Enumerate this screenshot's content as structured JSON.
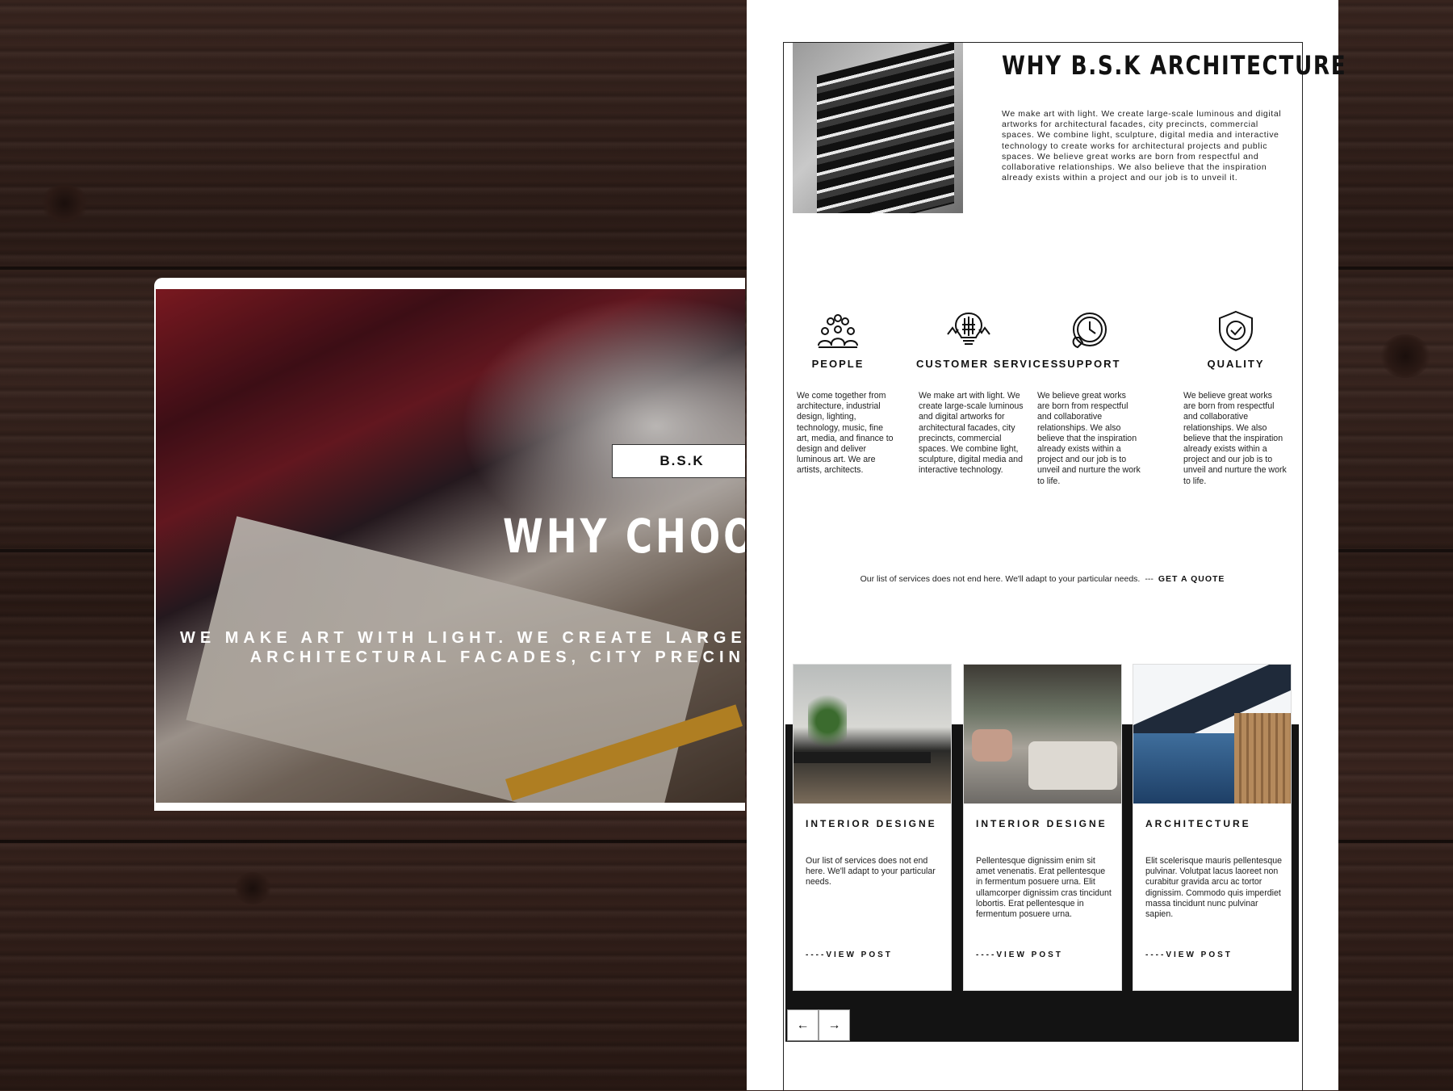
{
  "hero": {
    "logo": "B.S.K",
    "title": "WHY CHOOS",
    "subtitle_line1": "WE MAKE ART WITH LIGHT. WE CREATE LARGE-SCALE",
    "subtitle_line2": "ARCHITECTURAL FACADES, CITY PRECIN"
  },
  "about": {
    "title": "WHY B.S.K ARCHITECTURE",
    "text": "We make art with light. We create large-scale luminous and digital artworks for architectural facades, city precincts, commercial spaces. We combine light, sculpture, digital media and interactive technology to create works for architectural projects and public spaces. We believe great works are born from respectful and collaborative relationships. We also believe that the inspiration already exists within a project and our job is to unveil it."
  },
  "features": [
    {
      "icon": "people-icon",
      "title": "PEOPLE",
      "text": "We come together from architecture, industrial design, lighting, technology, music, fine art, media, and finance to design and deliver luminous art. We are artists, architects."
    },
    {
      "icon": "lightbulb-brain-icon",
      "title": "CUSTOMER SERVICES",
      "text": "We make art with light. We create large-scale luminous and digital artworks for architectural facades, city precincts, commercial spaces. We combine light, sculpture, digital media and interactive technology."
    },
    {
      "icon": "clock-support-icon",
      "title": "SUPPORT",
      "text": "We believe great works are born from respectful and collaborative relationships. We also believe that the inspiration already exists within a project and our job is to unveil and nurture the work to life."
    },
    {
      "icon": "shield-check-icon",
      "title": "QUALITY",
      "text": "We believe great works are born from respectful and collaborative relationships. We also believe that the inspiration already exists within a project and our job is to unveil and nurture the work to life."
    }
  ],
  "cta": {
    "text": "Our list of services does not end here. We'll adapt to your particular needs.",
    "dash": "---",
    "link": "GET A QUOTE"
  },
  "cards": [
    {
      "title": "INTERIOR DESIGNE",
      "text": "Our list of services does not end here. We'll adapt to your particular needs.",
      "link": "----VIEW POST"
    },
    {
      "title": "INTERIOR DESIGNE",
      "text": "Pellentesque dignissim enim sit amet venenatis. Erat pellentesque in fermentum posuere urna. Elit ullamcorper dignissim cras tincidunt lobortis. Erat pellentesque in fermentum posuere urna.",
      "link": "----VIEW POST"
    },
    {
      "title": "ARCHITECTURE",
      "text": "Elit scelerisque mauris pellentesque pulvinar. Volutpat lacus laoreet non curabitur gravida arcu ac tortor dignissim. Commodo quis imperdiet massa tincidunt nunc pulvinar sapien.",
      "link": "----VIEW POST"
    }
  ],
  "nav": {
    "prev": "←",
    "next": "→"
  },
  "colors": {
    "dark": "#131313",
    "wood": "#3a2620",
    "accent_yellow": "#e3a52a"
  }
}
